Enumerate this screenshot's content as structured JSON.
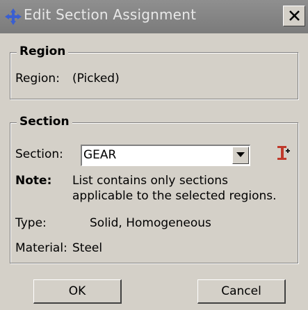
{
  "window": {
    "title": "Edit Section Assignment",
    "close_glyph": "X",
    "icon": "move-arrows-icon"
  },
  "region_group": {
    "title": "Region",
    "label": "Region:",
    "value": "(Picked)"
  },
  "section_group": {
    "title": "Section",
    "section_label": "Section:",
    "section_value": "GEAR",
    "create_icon": "create-section-icon",
    "note_label": "Note:",
    "note_line1": "List contains only sections",
    "note_line2": "applicable to the selected regions.",
    "type_label": "Type:",
    "type_value": "Solid, Homogeneous",
    "material_label": "Material:",
    "material_value": "Steel"
  },
  "buttons": {
    "ok": "OK",
    "cancel": "Cancel"
  },
  "colors": {
    "dialog_bg": "#d4d0c8",
    "titlebar_bg": "#808080",
    "title_text": "#e8e8e8",
    "title_icon": "#3a5fd0",
    "create_icon": "#c0392b"
  }
}
